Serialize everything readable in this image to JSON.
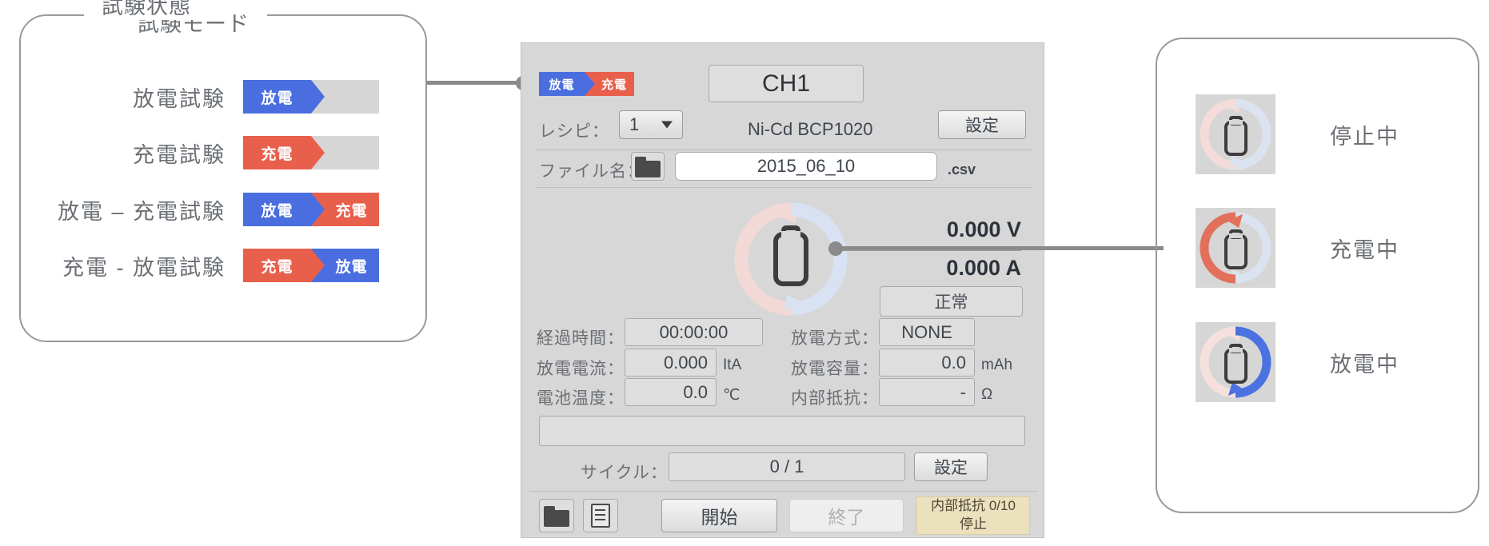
{
  "left_panel": {
    "title": "試験モード",
    "rows": [
      {
        "label": "放電試験",
        "chips": [
          {
            "text": "放電",
            "color": "blue"
          }
        ]
      },
      {
        "label": "充電試験",
        "chips": [
          {
            "text": "充電",
            "color": "red"
          }
        ]
      },
      {
        "label": "放電 – 充電試験",
        "chips": [
          {
            "text": "放電",
            "color": "blue"
          },
          {
            "text": "充電",
            "color": "red"
          }
        ]
      },
      {
        "label": "充電 - 放電試験",
        "chips": [
          {
            "text": "充電",
            "color": "red"
          },
          {
            "text": "放電",
            "color": "blue"
          }
        ]
      }
    ]
  },
  "center_panel": {
    "mode_badge": [
      {
        "text": "放電",
        "color": "blue"
      },
      {
        "text": "充電",
        "color": "red"
      }
    ],
    "channel_title": "CH1",
    "recipe_label": "レシピ：",
    "recipe_value": "1",
    "recipe_name": "Ni-Cd BCP1020",
    "recipe_settings_button": "設定",
    "filename_label": "ファイル名：",
    "filename_value": "2015_06_10",
    "filename_extension": ".csv",
    "folder_icon": "folder-icon",
    "voltage": "0.000 V",
    "current": "0.000 A",
    "condition": "正常",
    "metrics": [
      {
        "label": "経過時間：",
        "value": "00:00:00",
        "unit": "",
        "align": "center"
      },
      {
        "label": "放電方式：",
        "value": "NONE",
        "unit": "",
        "align": "center"
      },
      {
        "label": "放電電流：",
        "value": "0.000",
        "unit": "ItA",
        "align": "right"
      },
      {
        "label": "放電容量：",
        "value": "0.0",
        "unit": "mAh",
        "align": "right"
      },
      {
        "label": "電池温度：",
        "value": "0.0",
        "unit": "℃",
        "align": "right"
      },
      {
        "label": "内部抵抗：",
        "value": "-",
        "unit": "Ω",
        "align": "right"
      }
    ],
    "progress_value": "",
    "cycle_label": "サイクル：",
    "cycle_value": "0 / 1",
    "cycle_settings_button": "設定",
    "open_folder_icon": "open-folder-icon",
    "log_icon": "document-icon",
    "start_button": "開始",
    "stop_button": "終了",
    "resistance_status_line1": "内部抵抗 0/10",
    "resistance_status_line2": "停止"
  },
  "right_panel": {
    "title": "試験状態",
    "rows": [
      {
        "label": "停止中",
        "state": "idle"
      },
      {
        "label": "充電中",
        "state": "charging"
      },
      {
        "label": "放電中",
        "state": "discharging"
      }
    ]
  },
  "colors": {
    "blue": "#4a6ee0",
    "red": "#e8604c",
    "panel_bg": "#d7d7d7",
    "tray_bg": "#d6d6d6",
    "warn_bg": "#ece1bd",
    "line": "#8a8a8a"
  }
}
